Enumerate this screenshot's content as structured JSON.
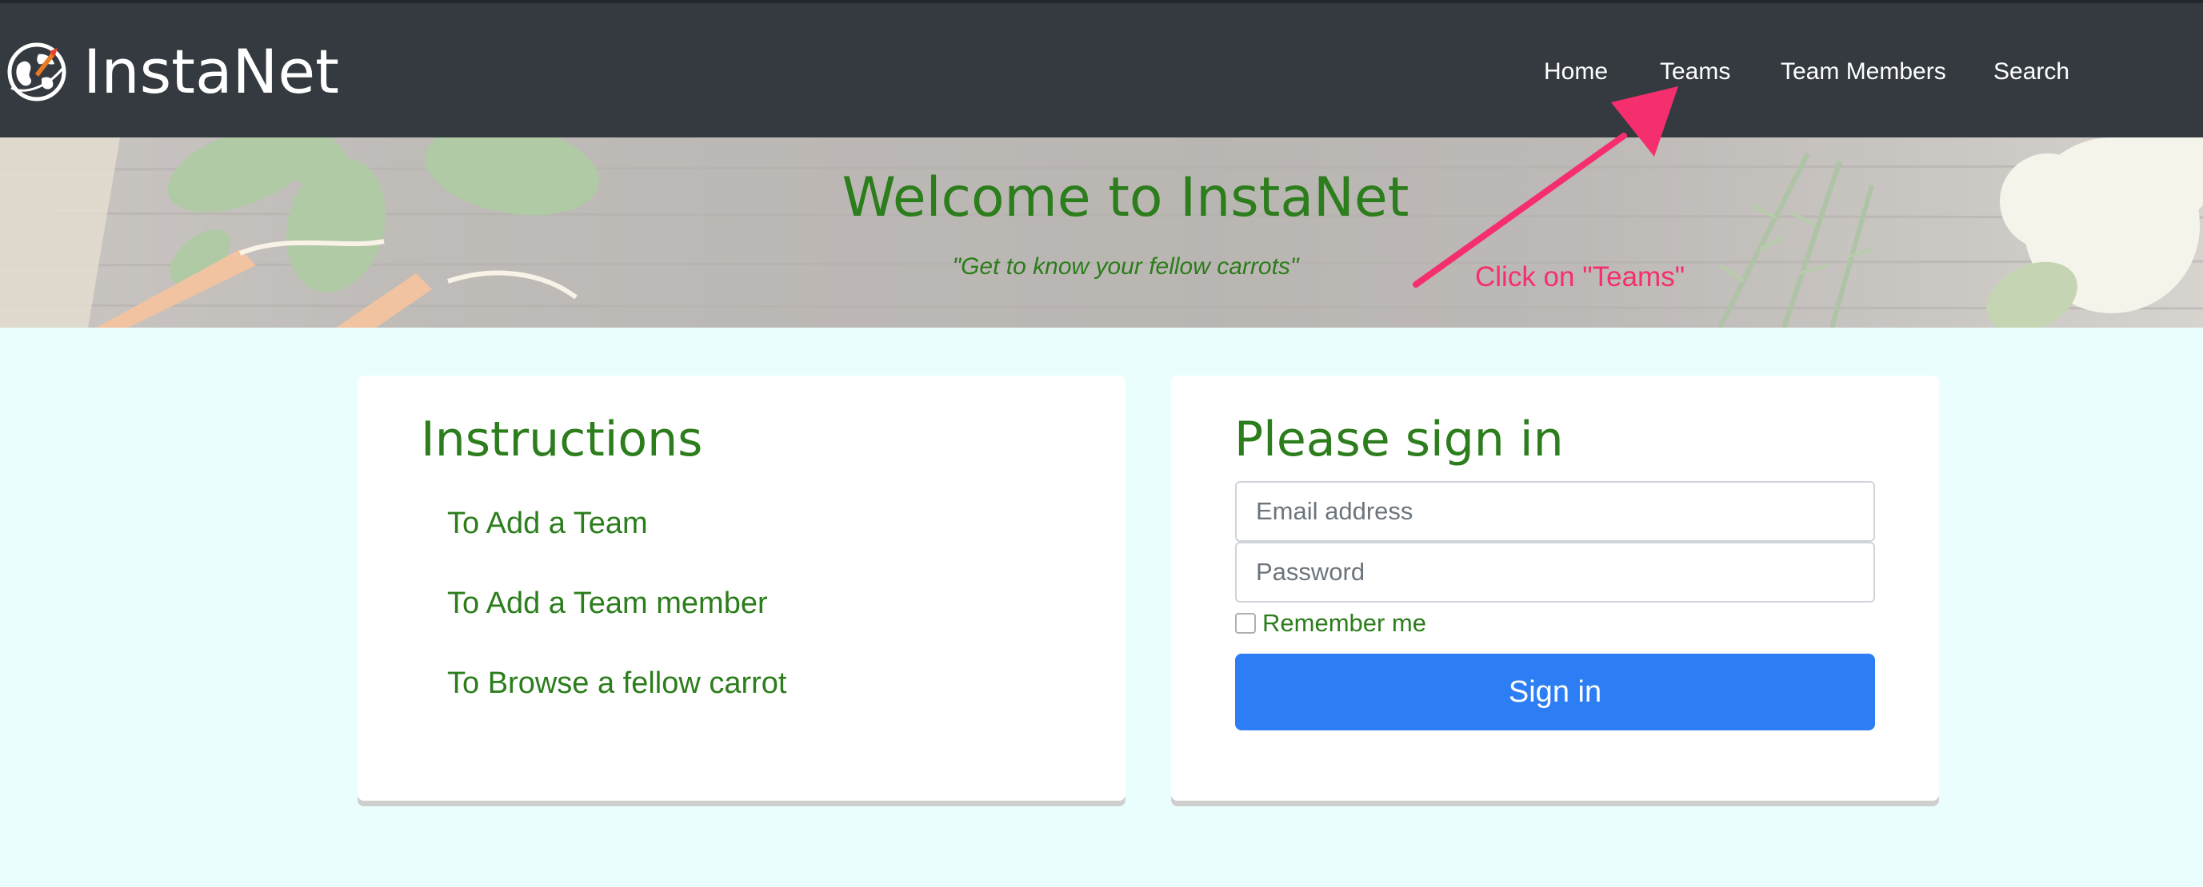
{
  "navbar": {
    "brand": "InstaNet",
    "brand_icon": "globe-rocket-icon",
    "links": [
      "Home",
      "Teams",
      "Team Members",
      "Search"
    ]
  },
  "hero": {
    "title": "Welcome to InstaNet",
    "subtitle": "\"Get to know your fellow carrots\""
  },
  "annotation": {
    "text": "Click on \"Teams\"",
    "color": "#f52f6e",
    "icon": "arrow-icon"
  },
  "instructions": {
    "title": "Instructions",
    "items": [
      "To Add a Team",
      "To Add a Team member",
      "To Browse a fellow carrot"
    ]
  },
  "signin": {
    "title": "Please sign in",
    "email_placeholder": "Email address",
    "email_value": "",
    "password_placeholder": "Password",
    "password_value": "",
    "remember_label": "Remember me",
    "remember_checked": false,
    "button_label": "Sign in"
  },
  "colors": {
    "navbar_bg": "#343a40",
    "accent_green": "#2c7d1c",
    "page_bg": "#eafffd",
    "button_blue": "#2d7ef5"
  }
}
